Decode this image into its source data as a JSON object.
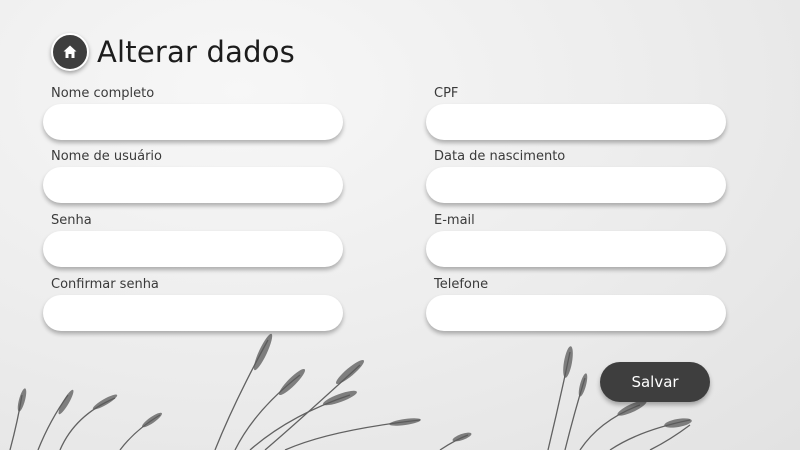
{
  "header": {
    "title": "Alterar dados",
    "home_icon": "home-icon"
  },
  "form": {
    "left": [
      {
        "label": "Nome completo",
        "value": ""
      },
      {
        "label": "Nome de usuário",
        "value": ""
      },
      {
        "label": "Senha",
        "value": ""
      },
      {
        "label": "Confirmar senha",
        "value": ""
      }
    ],
    "right": [
      {
        "label": "CPF",
        "value": ""
      },
      {
        "label": "Data de nascimento",
        "value": ""
      },
      {
        "label": "E-mail",
        "value": ""
      },
      {
        "label": "Telefone",
        "value": ""
      }
    ]
  },
  "actions": {
    "save_label": "Salvar"
  },
  "colors": {
    "button_bg": "#3e3e3e",
    "input_bg": "#ffffff",
    "text": "#1c1c1c"
  }
}
